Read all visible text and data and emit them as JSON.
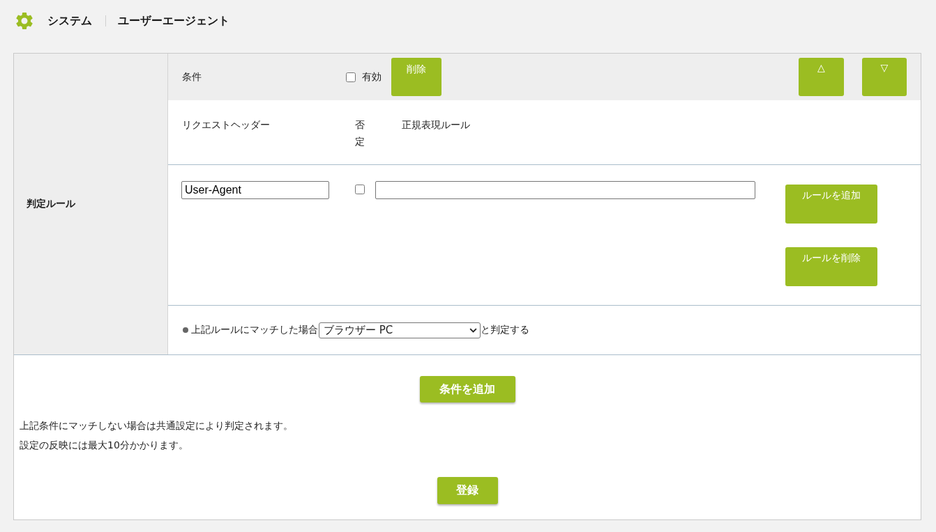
{
  "breadcrumb": [
    {
      "label": "システム"
    },
    {
      "label": "ユーザーエージェント"
    }
  ],
  "rule_section": {
    "label": "判定ルール",
    "conditions": [
      {
        "title": "条件",
        "enabled": {
          "label": "有効",
          "checked": false
        },
        "delete_button": "削除",
        "move_up_button": "△",
        "move_down_button": "▽",
        "columns": [
          "リクエストヘッダー",
          "否定",
          "正規表現ルール"
        ],
        "rules": [
          {
            "header": "User-Agent",
            "negate": false
          }
        ],
        "add_rule_button": "ルールを追加",
        "delete_rule_button": "ルールを削除",
        "result": {
          "prefix": "上記ルールにマッチした場合",
          "selected_option": "ブラウザー PC",
          "suffix": "と判定する"
        }
      }
    ]
  },
  "add_condition_button": "条件を追加",
  "notes": [
    "上記条件にマッチしない場合は共通設定により判定されます。",
    "設定の反映には最大10分かかります。"
  ],
  "submit_button": "登録"
}
